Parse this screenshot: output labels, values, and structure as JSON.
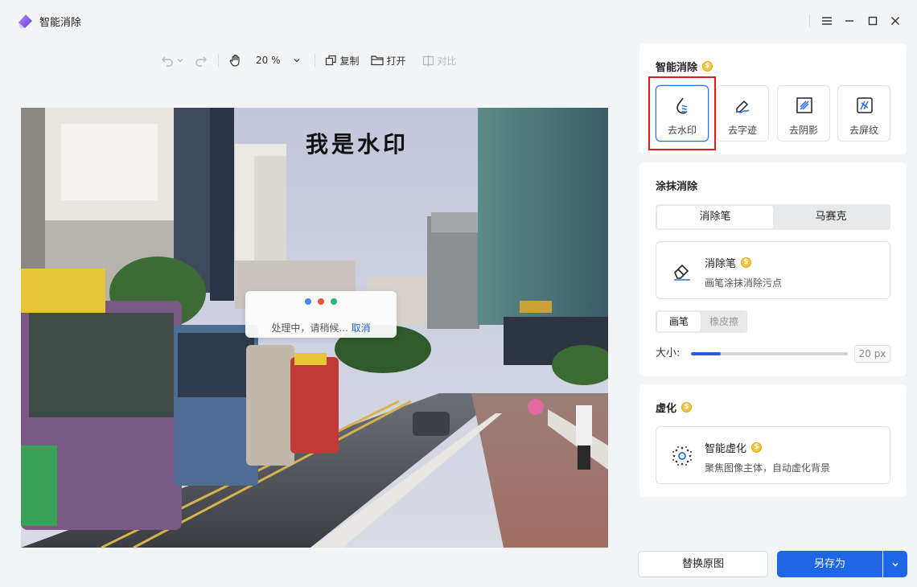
{
  "app": {
    "title": "智能消除",
    "logo": "eraser-logo-icon"
  },
  "window_controls": [
    "menu-icon",
    "minimize-icon",
    "maximize-icon",
    "close-icon"
  ],
  "toolbar": {
    "zoom": "20 %",
    "copy_label": "复制",
    "open_label": "打开",
    "compare_label": "对比"
  },
  "canvas": {
    "watermark_text": "我是水印",
    "progress_text": "处理中，请稍候...",
    "cancel_label": "取消",
    "dot_colors": [
      "#4a86f0",
      "#e5533d",
      "#2bb673"
    ]
  },
  "smart_erase": {
    "title": "智能消除",
    "tools": [
      {
        "label": "去水印",
        "icon": "watermark-remove-icon",
        "selected": true
      },
      {
        "label": "去字迹",
        "icon": "handwriting-remove-icon",
        "selected": false
      },
      {
        "label": "去阴影",
        "icon": "shadow-remove-icon",
        "selected": false
      },
      {
        "label": "去屏纹",
        "icon": "moire-remove-icon",
        "selected": false
      }
    ]
  },
  "smear_erase": {
    "title": "涂抹消除",
    "tabs": [
      "消除笔",
      "马赛克"
    ],
    "active_tab": "消除笔",
    "card_title": "消除笔",
    "card_desc": "画笔涂抹消除污点",
    "modes": [
      "画笔",
      "橡皮擦"
    ],
    "active_mode": "画笔",
    "size_label": "大小:",
    "size_value": "20",
    "size_unit": "px",
    "size_fraction": 0.19
  },
  "blur": {
    "title": "虚化",
    "card_title": "智能虚化",
    "card_desc": "聚焦图像主体，自动虚化背景"
  },
  "footer": {
    "replace_label": "替换原图",
    "save_label": "另存为"
  },
  "colors": {
    "accent": "#1f66e5",
    "highlight": "#e21b1b",
    "coin": "#f4c542"
  }
}
